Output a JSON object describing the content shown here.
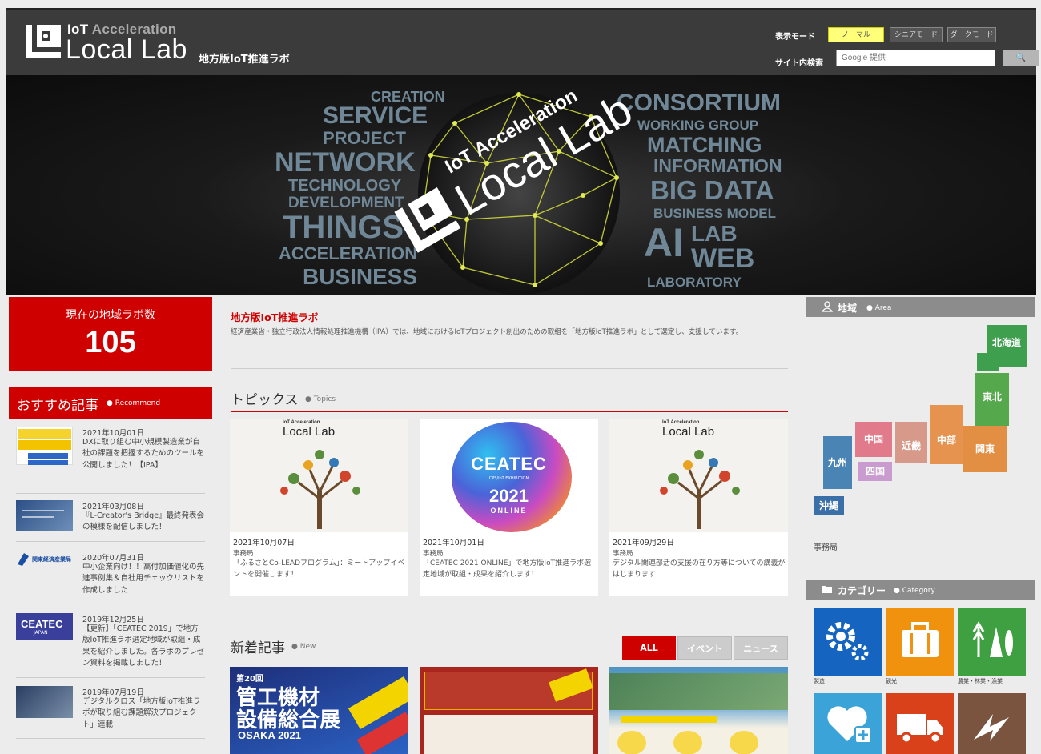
{
  "header": {
    "logo_top_prefix": "IoT ",
    "logo_top_accel": "Acceleration",
    "logo_main": "Local Lab",
    "logo_sub": "地方版IoT推進ラボ",
    "mode_label": "表示モード",
    "modes": [
      "ノーマル",
      "シニアモード",
      "ダークモード"
    ],
    "search_label": "サイト内検索",
    "search_placeholder": "Google 提供",
    "search_button": "🔍"
  },
  "hero": {
    "words_left": [
      "CREATION",
      "SERVICE",
      "PROJECT",
      "NETWORK",
      "TECHNOLOGY",
      "DEVELOPMENT",
      "THINGS",
      "ACCELERATION",
      "BUSINESS"
    ],
    "words_right": [
      "CONSORTIUM",
      "WORKING GROUP",
      "MATCHING",
      "INFORMATION",
      "BIG DATA",
      "BUSINESS MODEL",
      "AI",
      "LAB",
      "WEB",
      "LABORATORY"
    ],
    "logo_small": "IoT Acceleration",
    "logo_big": "Local Lab"
  },
  "left": {
    "count_label": "現在の地域ラボ数",
    "count_value": "105",
    "rec_title": "おすすめ記事",
    "rec_sub": "Recommend",
    "items": [
      {
        "date": "2021年10月01日",
        "text": "DXに取り組む中小規模製造業が自社の課題を把握するためのツールを公開しました！【IPA】"
      },
      {
        "date": "2021年03月08日",
        "text": "『L-Creator's Bridge』最終発表会の模様を配信しました！"
      },
      {
        "date": "2020年07月31日",
        "text": "中小企業向け！！高付加価値化の先進事例集＆自社用チェックリストを作成しました"
      },
      {
        "date": "2019年12月25日",
        "text": "【更新】「CEATEC 2019」で地方版IoT推進ラボ選定地域が取組・成果を紹介しました。各ラボのプレゼン資料を掲載しました！"
      },
      {
        "date": "2019年07月19日",
        "text": "デジタルクロス「地方版IoT推進ラボが取り組む課題解決プロジェクト」連載"
      }
    ],
    "thumb_ceatec": "CEATEC",
    "thumb_ceatec_sub": "JAPAN",
    "thumb_kanto": "関東経済産業局"
  },
  "center": {
    "lab_title": "地方版IoT推進ラボ",
    "lab_desc": "経済産業省・独立行政法人情報処理推進機構（IPA）では、地域におけるIoTプロジェクト創出のための取組を「地方版IoT推進ラボ」として選定し、支援しています。",
    "topics_title": "トピックス",
    "topics_sub": "Topics",
    "topics": [
      {
        "date": "2021年10月07日",
        "author": "事務局",
        "text": "「ふるさとCo-LEADプログラム」：ミートアップイベントを開催します！"
      },
      {
        "date": "2021年10月01日",
        "author": "事務局",
        "text": "「CEATEC 2021 ONLINE」で地方版IoT推進ラボ選定地域が取組・成果を紹介します！"
      },
      {
        "date": "2021年09月29日",
        "author": "事務局",
        "text": "デジタル関連部活の支援の在り方等についての講義がはじまります"
      }
    ],
    "card_logo_small": "IoT Acceleration",
    "card_logo_big": "Local Lab",
    "ceatec_word": "CEATEC",
    "ceatec_year": "2021",
    "ceatec_online": "ONLINE",
    "ceatec_exhibit": "CPS/IoT EXHIBITION",
    "news_title": "新着記事",
    "news_sub": "New",
    "tabs": [
      "ALL",
      "イベント",
      "ニュース"
    ],
    "news1_line1": "第20回",
    "news1_line2": "管工機材",
    "news1_line3": "設備総合展",
    "news1_line4": "OSAKA 2021"
  },
  "right": {
    "area_title": "地域",
    "area_sub": "Area",
    "regions": [
      "北海道",
      "東北",
      "関東",
      "中部",
      "近畿",
      "中国",
      "四国",
      "九州",
      "沖縄"
    ],
    "office": "事務局",
    "category_title": "カテゴリー",
    "category_sub": "Category",
    "categories": [
      "製造",
      "観光",
      "農業・林業・漁業",
      "医療・福祉",
      "物流",
      "インフラ"
    ]
  },
  "colors": {
    "accent_red": "#cf0000",
    "hokkaido": "#3ea04f",
    "chubu": "#e28e43",
    "kinki": "#d79a8a",
    "chugoku": "#e17a8a",
    "kyushu": "#4a84b5",
    "cat_blue": "#1565c0",
    "cat_orange": "#f0920e",
    "cat_green": "#3fa042",
    "cat_sky": "#3ba3d8",
    "cat_red": "#d9411a",
    "cat_brown": "#7b5440"
  }
}
